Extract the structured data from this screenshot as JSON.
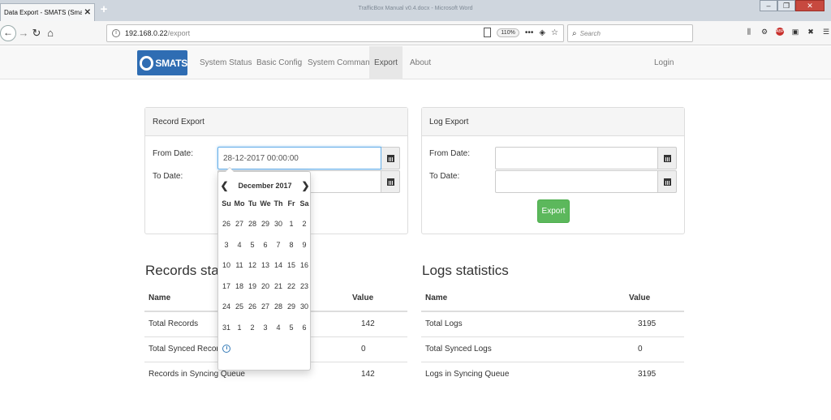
{
  "browser": {
    "tab_title": "Data Export - SMATS (Smart Traffic",
    "tab_close": "✕",
    "new_tab": "+",
    "window_title": "TrafficBox Manual v0.4.docx - Microsoft Word",
    "url_host": "192.168.0.22",
    "url_path": "/export",
    "zoom": "110%",
    "search_placeholder": "Search"
  },
  "app": {
    "brand": "SMATS",
    "nav": [
      "System Status",
      "Basic Config",
      "System Command",
      "Export",
      "About"
    ],
    "active_nav": "Export",
    "login": "Login"
  },
  "record_export": {
    "title": "Record Export",
    "from_label": "From Date:",
    "to_label": "To Date:",
    "from_value": "28-12-2017 00:00:00",
    "to_value": ""
  },
  "log_export": {
    "title": "Log Export",
    "from_label": "From Date:",
    "to_label": "To Date:",
    "from_value": "",
    "to_value": "",
    "export_button": "Export"
  },
  "records_stats": {
    "title": "Records statistics",
    "col_name": "Name",
    "col_value": "Value",
    "rows": [
      {
        "name": "Total Records",
        "value": "142"
      },
      {
        "name": "Total Synced Records",
        "value": "0"
      },
      {
        "name": "Records in Syncing Queue",
        "value": "142"
      }
    ]
  },
  "logs_stats": {
    "title": "Logs statistics",
    "col_name": "Name",
    "col_value": "Value",
    "rows": [
      {
        "name": "Total Logs",
        "value": "3195"
      },
      {
        "name": "Total Synced Logs",
        "value": "0"
      },
      {
        "name": "Logs in Syncing Queue",
        "value": "3195"
      }
    ]
  },
  "datepicker": {
    "month": "December 2017",
    "prev": "❮",
    "next": "❯",
    "weekdays": [
      "Su",
      "Mo",
      "Tu",
      "We",
      "Th",
      "Fr",
      "Sa"
    ],
    "days": [
      "26",
      "27",
      "28",
      "29",
      "30",
      "1",
      "2",
      "3",
      "4",
      "5",
      "6",
      "7",
      "8",
      "9",
      "10",
      "11",
      "12",
      "13",
      "14",
      "15",
      "16",
      "17",
      "18",
      "19",
      "20",
      "21",
      "22",
      "23",
      "24",
      "25",
      "26",
      "27",
      "28",
      "29",
      "30",
      "31",
      "1",
      "2",
      "3",
      "4",
      "5",
      "6"
    ]
  }
}
